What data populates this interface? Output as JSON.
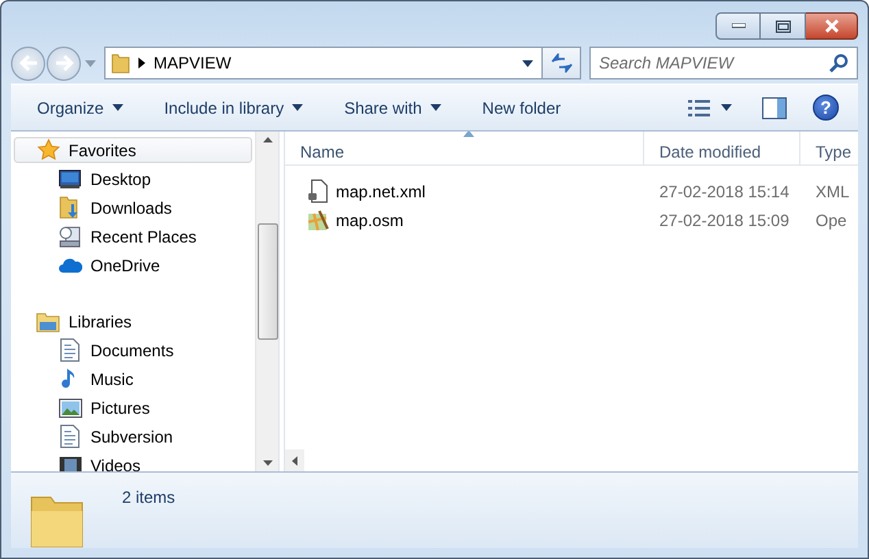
{
  "address_bar": {
    "path": "MAPVIEW"
  },
  "search": {
    "placeholder": "Search MAPVIEW"
  },
  "toolbar": {
    "items": [
      {
        "label": "Organize",
        "dropdown": true
      },
      {
        "label": "Include in library",
        "dropdown": true
      },
      {
        "label": "Share with",
        "dropdown": true
      },
      {
        "label": "New folder",
        "dropdown": false
      }
    ],
    "help_button": {
      "label": "?"
    }
  },
  "nav_pane": {
    "groups": [
      {
        "label": "Favorites",
        "kind": "star",
        "selected": true,
        "children": [
          {
            "label": "Desktop",
            "kind": "desktop",
            "selected": false
          },
          {
            "label": "Downloads",
            "kind": "downloads",
            "selected": false
          },
          {
            "label": "Recent Places",
            "kind": "recent",
            "selected": false
          },
          {
            "label": "OneDrive",
            "kind": "cloud",
            "selected": false
          }
        ]
      },
      {
        "label": "Libraries",
        "kind": "library",
        "selected": false,
        "children": [
          {
            "label": "Documents",
            "kind": "document",
            "selected": false
          },
          {
            "label": "Music",
            "kind": "music",
            "selected": false
          },
          {
            "label": "Pictures",
            "kind": "picture",
            "selected": false
          },
          {
            "label": "Subversion",
            "kind": "document",
            "selected": false
          },
          {
            "label": "Videos",
            "kind": "video",
            "selected": false
          }
        ]
      }
    ]
  },
  "file_list": {
    "columns": [
      {
        "label": "Name",
        "sorted": true
      },
      {
        "label": "Date modified",
        "sorted": false
      },
      {
        "label": "Type",
        "sorted": false
      }
    ],
    "rows": [
      {
        "kind": "xml",
        "cells": [
          "map.net.xml",
          "27-02-2018 15:14",
          "XML"
        ]
      },
      {
        "kind": "osm",
        "cells": [
          "map.osm",
          "27-02-2018 15:09",
          "Ope"
        ]
      }
    ]
  },
  "details_pane": {
    "summary": "2 items"
  }
}
